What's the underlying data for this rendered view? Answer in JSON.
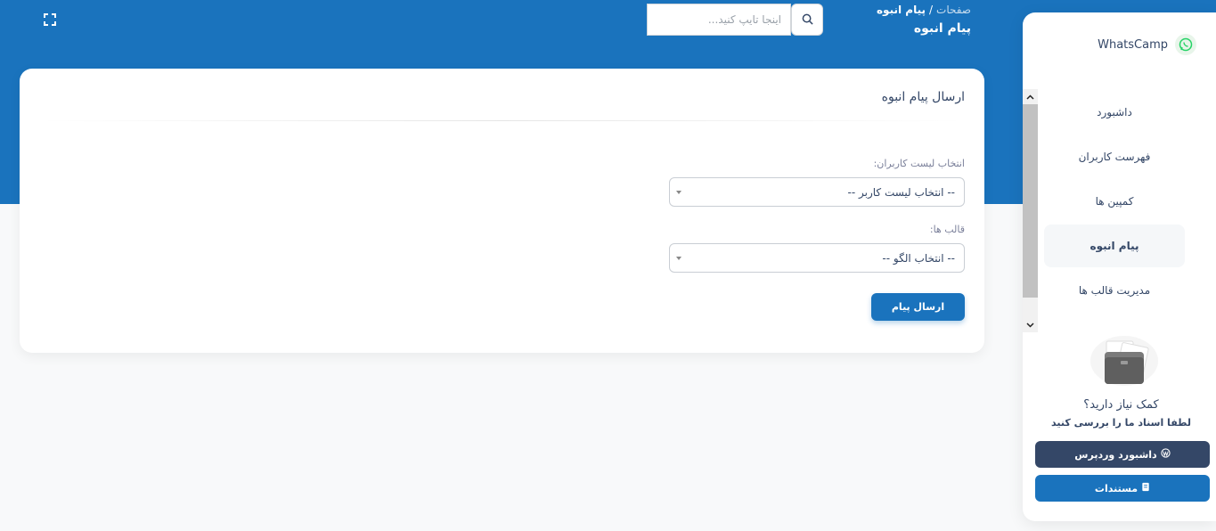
{
  "header": {
    "breadcrumb_root": "صفحات",
    "breadcrumb_separator": "/",
    "breadcrumb_current": "پیام انبوه",
    "page_title": "پیام انبوه",
    "search_placeholder": "اینجا تایپ کنید..."
  },
  "icons": {
    "fullscreen": "fullscreen-icon",
    "search": "search-icon",
    "whatsapp": "whatsapp-icon",
    "wordpress": "wordpress-icon",
    "book": "book-icon"
  },
  "card": {
    "title": "ارسال پیام انبوه",
    "user_list_label": "انتخاب لیست کاربران:",
    "user_list_value": "-- انتخاب لیست کاربر --",
    "template_label": "قالب ها:",
    "template_value": "-- انتخاب الگو --",
    "send_button": "ارسال پیام"
  },
  "sidebar": {
    "brand": "WhatsCamp",
    "items": [
      {
        "label": "داشبورد"
      },
      {
        "label": "فهرست کاربران"
      },
      {
        "label": "کمپین ها"
      },
      {
        "label": "پیام انبوه",
        "active": true
      },
      {
        "label": "مدیریت قالب ها"
      }
    ],
    "help_title": "کمک نیاز دارید؟",
    "help_subtitle": "لطفا اسناد ما را بررسی کنید",
    "wordpress_button": "داشبورد وردپرس",
    "docs_button": "مستندات"
  },
  "colors": {
    "primary": "#1a73bd",
    "dark": "#344767",
    "background": "#f8f9fa"
  }
}
